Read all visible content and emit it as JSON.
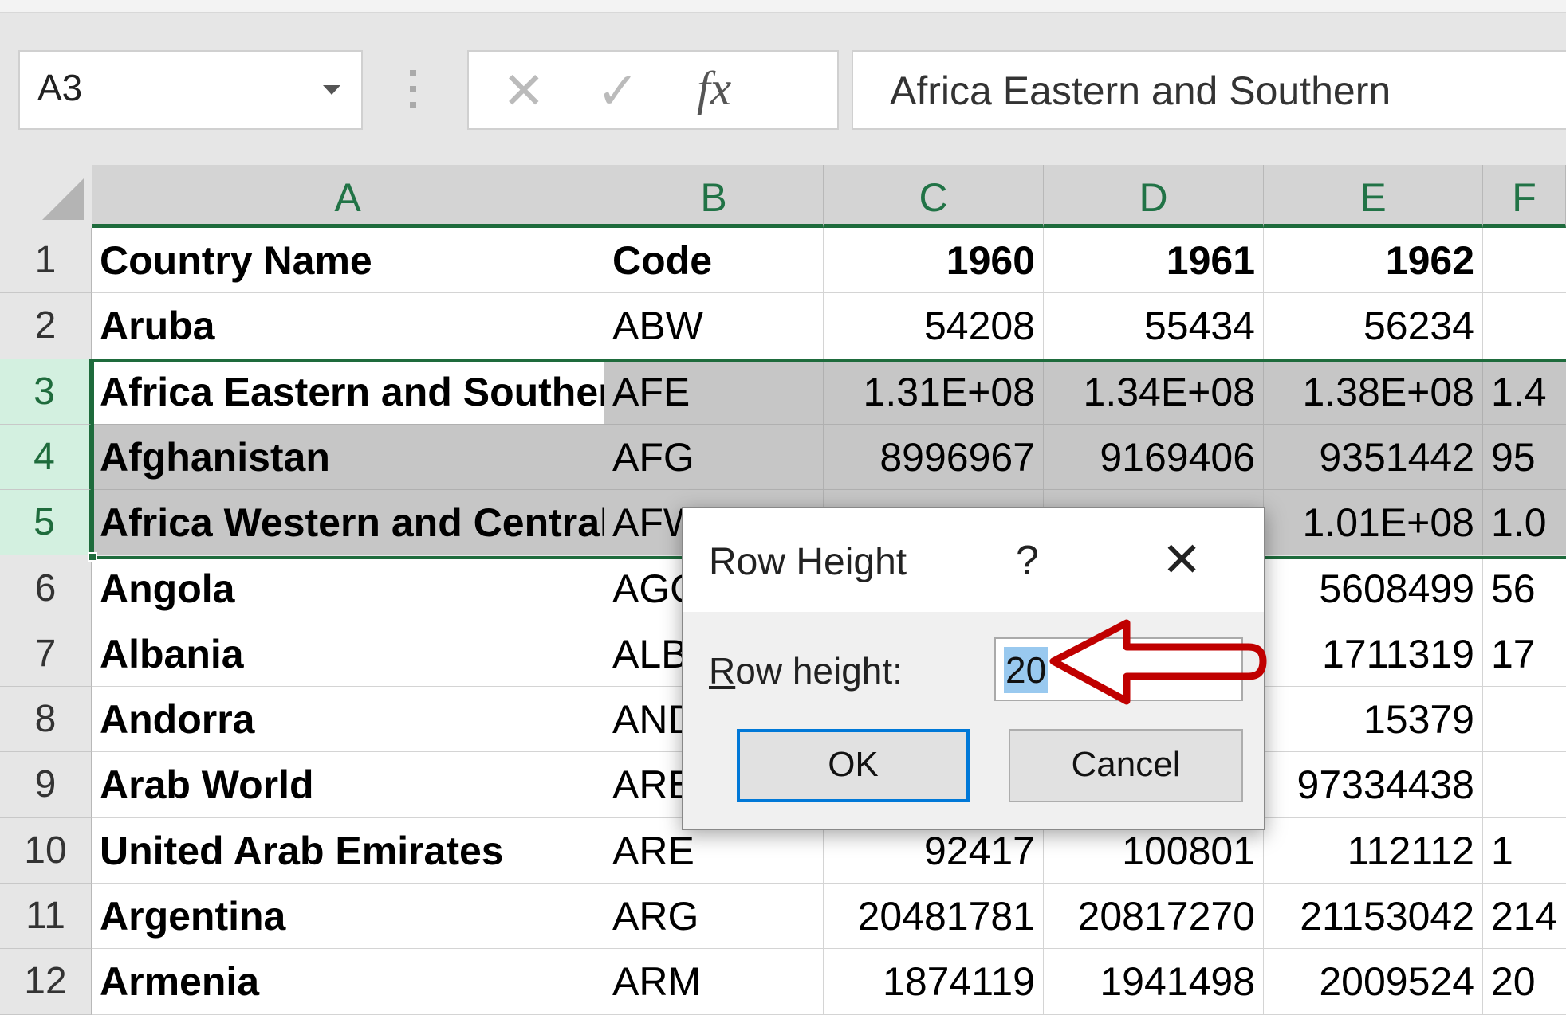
{
  "formula_bar": {
    "name_box": "A3",
    "cancel_icon": "✕",
    "enter_icon": "✓",
    "fx_label": "fx",
    "content": "Africa Eastern and Southern"
  },
  "columns": [
    "A",
    "B",
    "C",
    "D",
    "E",
    "F"
  ],
  "rows": [
    {
      "num": "1",
      "cells": [
        "Country Name",
        "Code",
        "1960",
        "1961",
        "1962",
        ""
      ]
    },
    {
      "num": "2",
      "cells": [
        "Aruba",
        "ABW",
        "54208",
        "55434",
        "56234",
        ""
      ]
    },
    {
      "num": "3",
      "cells": [
        "Africa Eastern and Southern",
        "AFE",
        "1.31E+08",
        "1.34E+08",
        "1.38E+08",
        "1.4"
      ]
    },
    {
      "num": "4",
      "cells": [
        "Afghanistan",
        "AFG",
        "8996967",
        "9169406",
        "9351442",
        "95"
      ]
    },
    {
      "num": "5",
      "cells": [
        "Africa Western and Central",
        "AFW",
        "",
        "",
        "1.01E+08",
        "1.0"
      ]
    },
    {
      "num": "6",
      "cells": [
        "Angola",
        "AGO",
        "",
        "",
        "5608499",
        "56"
      ]
    },
    {
      "num": "7",
      "cells": [
        "Albania",
        "ALB",
        "",
        "",
        "1711319",
        "17"
      ]
    },
    {
      "num": "8",
      "cells": [
        "Andorra",
        "AND",
        "",
        "",
        "15379",
        ""
      ]
    },
    {
      "num": "9",
      "cells": [
        "Arab World",
        "ARB",
        "",
        "",
        "97334438",
        ""
      ]
    },
    {
      "num": "10",
      "cells": [
        "United Arab Emirates",
        "ARE",
        "92417",
        "100801",
        "112112",
        "1"
      ]
    },
    {
      "num": "11",
      "cells": [
        "Argentina",
        "ARG",
        "20481781",
        "20817270",
        "21153042",
        "214"
      ]
    },
    {
      "num": "12",
      "cells": [
        "Armenia",
        "ARM",
        "1874119",
        "1941498",
        "2009524",
        "20"
      ]
    }
  ],
  "selection": {
    "active_cell": "A3",
    "rows": [
      "3",
      "4",
      "5"
    ]
  },
  "dialog": {
    "title": "Row Height",
    "help": "?",
    "close": "✕",
    "label_accel": "R",
    "label_rest": "ow height:",
    "value": "20",
    "ok": "OK",
    "cancel": "Cancel"
  },
  "colors": {
    "accent_green": "#1e6b3c",
    "annotation_arrow": "#c00000",
    "ok_border": "#0078d7"
  }
}
